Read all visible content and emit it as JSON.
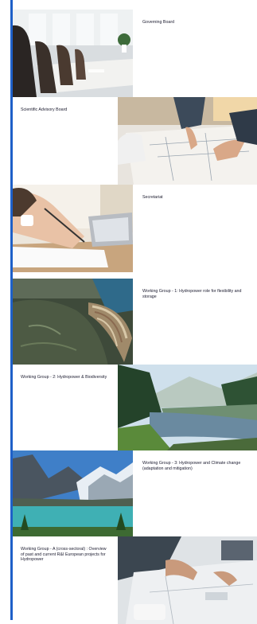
{
  "groups": [
    {
      "title": "Governing Board",
      "image_icon": "boardroom-photo"
    },
    {
      "title": "Scientific Advisory Board",
      "image_icon": "blueprints-photo"
    },
    {
      "title": "Secretariat",
      "image_icon": "writing-desk-photo"
    },
    {
      "title": "Working Group - 1: Hydropower role for flexibility and storage",
      "image_icon": "dam-aerial-photo"
    },
    {
      "title": "Working Group - 2: Hydropower & Biodiversity",
      "image_icon": "river-forest-photo"
    },
    {
      "title": "Working Group - 3: Hydropower and Climate change (adaptation and mitigation)",
      "image_icon": "alpine-lake-photo"
    },
    {
      "title": "Working Group - A (cross-sectoral) : Overview of past and current R&I European projects for Hydropower",
      "image_icon": "meeting-plans-photo"
    }
  ],
  "colors": {
    "accent_border": "#1e60c8",
    "text": "#1a1a2e"
  }
}
